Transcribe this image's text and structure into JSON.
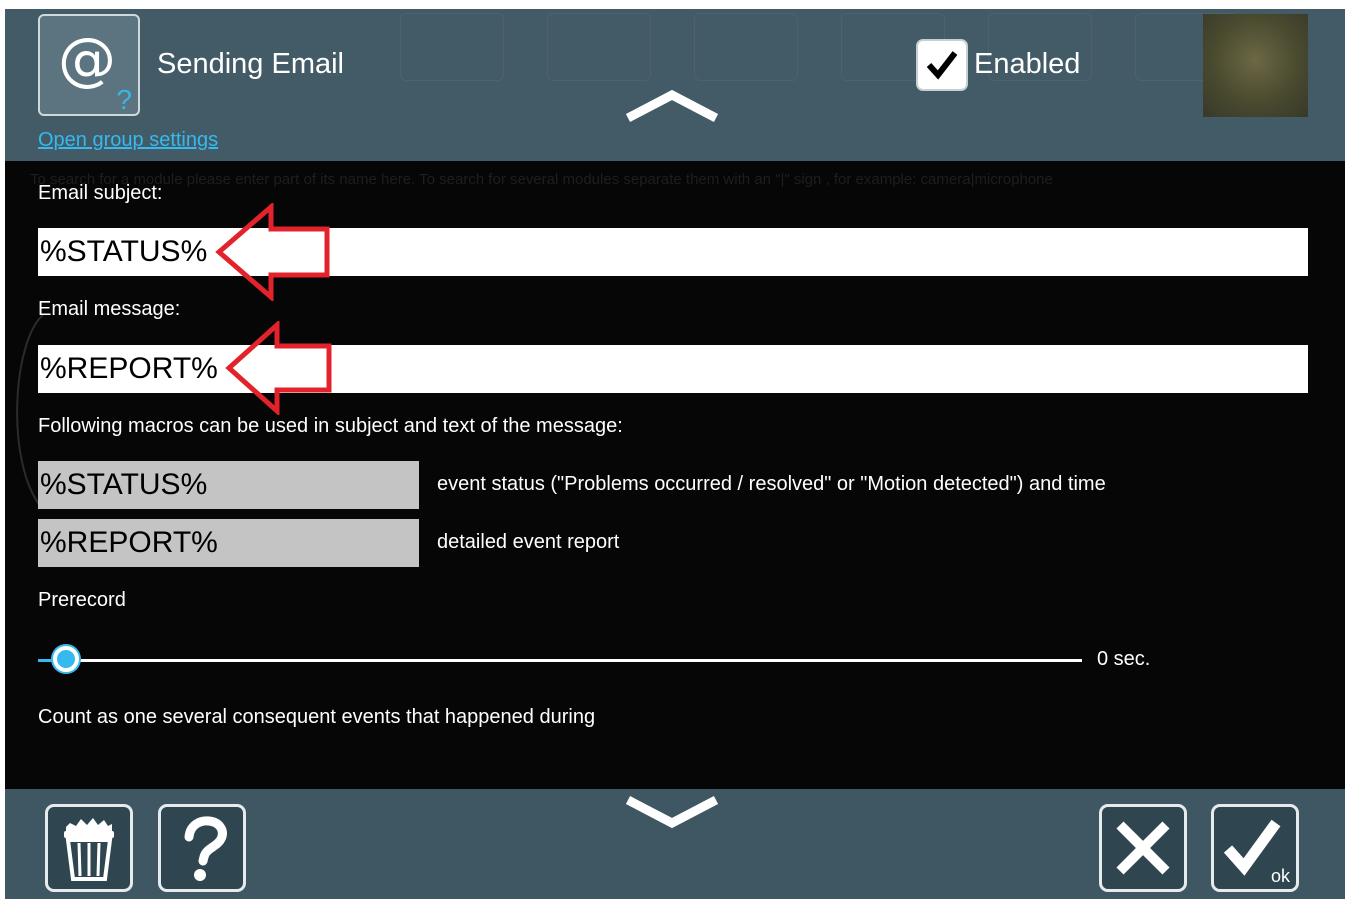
{
  "header": {
    "module_title": "Sending Email",
    "group_settings_link": "Open group settings",
    "enabled_label": "Enabled",
    "enabled_checked": true,
    "icon_glyph": "@",
    "icon_badge": "?"
  },
  "search_hint": "To search for a module please enter part of its name here. To search for several modules separate them with an \"|\" sign , for example: camera|microphone",
  "form": {
    "subject_label": "Email subject:",
    "subject_value": "%STATUS%",
    "message_label": "Email message:",
    "message_value": "%REPORT%",
    "macros_intro": "Following macros can be used in subject and text of the message:",
    "macros": [
      {
        "name": "%STATUS%",
        "description": "event status (\"Problems occurred / resolved\" or \"Motion detected\") and time"
      },
      {
        "name": "%REPORT%",
        "description": "detailed event report"
      }
    ],
    "prerecord_label": "Prerecord",
    "prerecord_value": "0 sec.",
    "prerecord_level": 0,
    "consequent_label": "Count as one several consequent events that happened during"
  },
  "footer": {
    "ok_sub": "ok"
  },
  "colors": {
    "accent": "#35b9ee",
    "annotation_arrow": "#e3232b",
    "panel_bg": "#060606",
    "chrome_bg": "#3d545f"
  },
  "icons": [
    "at-sign-icon",
    "question-mark-icon",
    "chevron-up-icon",
    "checkmark-icon",
    "chevron-down-icon",
    "trash-icon",
    "help-icon",
    "close-x-icon",
    "ok-check-icon"
  ]
}
